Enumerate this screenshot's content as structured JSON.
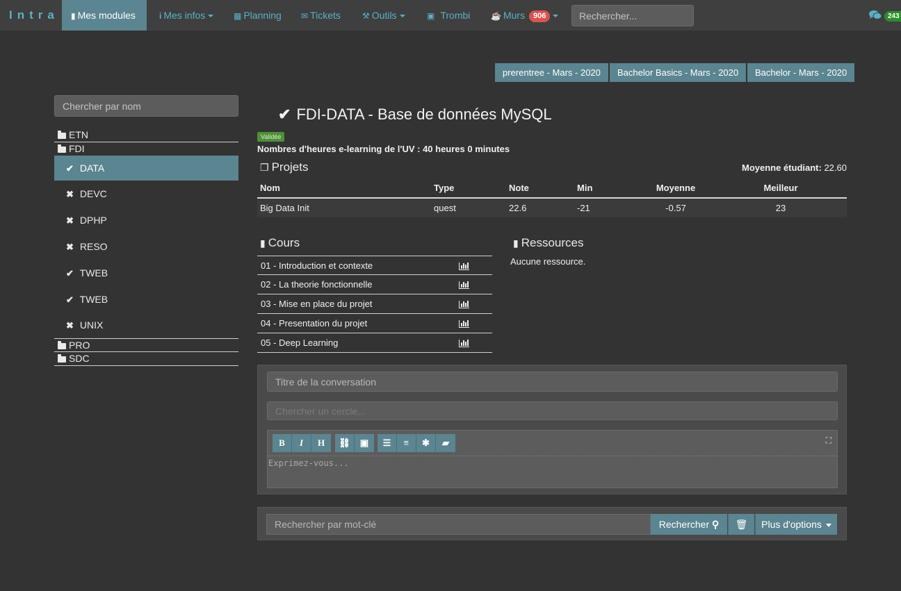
{
  "nav": {
    "brand": "Intra",
    "items": [
      {
        "label": "Mes modules",
        "icon": "book-icon"
      },
      {
        "label": "Mes infos",
        "icon": "info-icon"
      },
      {
        "label": "Planning",
        "icon": "calendar-icon"
      },
      {
        "label": "Tickets",
        "icon": "envelope-icon"
      },
      {
        "label": "Outils",
        "icon": "wrench-icon"
      },
      {
        "label": "Trombi",
        "icon": "picture-icon"
      },
      {
        "label": "Murs",
        "icon": "cup-icon",
        "badge": "906"
      }
    ],
    "search_placeholder": "Rechercher...",
    "chat_badge": "243"
  },
  "semesters": [
    "prerentree - Mars - 2020",
    "Bachelor Basics - Mars - 2020",
    "Bachelor - Mars - 2020"
  ],
  "sidebar": {
    "search_placeholder": "Chercher par nom",
    "folders": [
      "ETN",
      "FDI",
      "PRO",
      "SDC"
    ],
    "modules": [
      {
        "label": "DATA",
        "status": "✔"
      },
      {
        "label": "DEVC",
        "status": "✖"
      },
      {
        "label": "DPHP",
        "status": "✖"
      },
      {
        "label": "RESO",
        "status": "✖"
      },
      {
        "label": "TWEB",
        "status": "✔"
      },
      {
        "label": "TWEB",
        "status": "✔"
      },
      {
        "label": "UNIX",
        "status": "✖"
      }
    ]
  },
  "module": {
    "title": "FDI-DATA - Base de données MySQL",
    "status_badge": "Validée",
    "hours": "Nombres d'heures e-learning de l'UV : 40 heures 0 minutes"
  },
  "projets": {
    "heading": "Projets",
    "average_label": "Moyenne étudiant:",
    "average_value": "22.60",
    "columns": [
      "Nom",
      "Type",
      "Note",
      "Min",
      "Moyenne",
      "Meilleur"
    ],
    "rows": [
      [
        "Big Data Init",
        "quest",
        "22.6",
        "-21",
        "-0.57",
        "23"
      ]
    ]
  },
  "cours": {
    "heading": "Cours",
    "items": [
      "01 - Introduction et contexte",
      "02 - La theorie fonctionnelle",
      "03 - Mise en place du projet",
      "04 - Presentation du projet",
      "05 - Deep Learning"
    ]
  },
  "ressources": {
    "heading": "Ressources",
    "empty_text": "Aucune ressource."
  },
  "conversation": {
    "title_placeholder": "Titre de la conversation",
    "circle_placeholder": "Chercher un cercle...",
    "toolbar": [
      "B",
      "I",
      "H",
      "link",
      "image",
      "ol",
      "ul",
      "bug",
      "comment"
    ],
    "editor_placeholder": "Exprimez-vous..."
  },
  "search": {
    "placeholder": "Rechercher par mot-clé",
    "search_label": "Rechercher",
    "options_label": "Plus d'options"
  }
}
